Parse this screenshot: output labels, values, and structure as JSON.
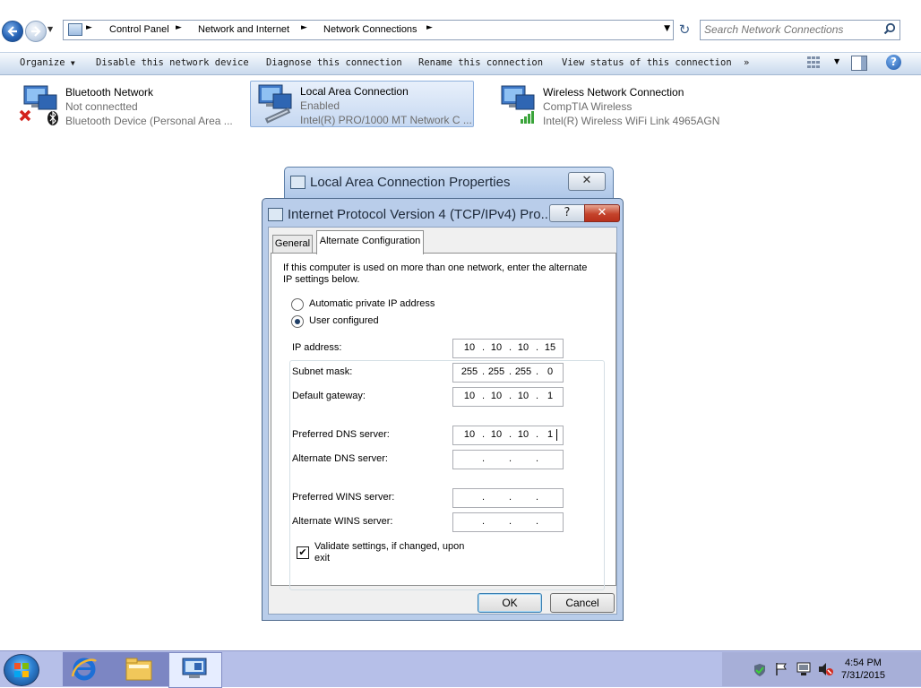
{
  "address_bar": {
    "breadcrumbs": [
      "Control Panel",
      "Network and Internet",
      "Network Connections"
    ],
    "search_placeholder": "Search Network Connections"
  },
  "command_bar": {
    "organize": "Organize",
    "disable": "Disable this network device",
    "diagnose": "Diagnose this connection",
    "rename": "Rename this connection",
    "view_status": "View status of this connection",
    "more": "»"
  },
  "connections": [
    {
      "title": "Bluetooth Network",
      "status": "Not connectted",
      "device": "Bluetooth Device (Personal Area ..."
    },
    {
      "title": "Local Area Connection",
      "status": "Enabled",
      "device": "Intel(R) PRO/1000 MT Network C ..."
    },
    {
      "title": "Wireless Network Connection",
      "status": "CompTIA Wireless",
      "device": "Intel(R) Wireless WiFi Link 4965AGN"
    }
  ],
  "lac_dialog": {
    "title": "Local Area Connection Properties"
  },
  "ipv4_dialog": {
    "title": "Internet Protocol Version 4 (TCP/IPv4) Pro...",
    "help_btn": "?",
    "close_btn": "✕",
    "tabs": [
      "General",
      "Alternate Configuration"
    ],
    "active_tab": "Alternate Configuration",
    "intro": "If this computer is used on more than one network, enter the alternate IP settings below.",
    "radio_auto": "Automatic private IP address",
    "radio_user": "User configured",
    "selected_radio": "User configured",
    "fields": [
      {
        "label": "IP address:",
        "octets": [
          "10",
          "10",
          "10",
          "15"
        ]
      },
      {
        "label": "Subnet mask:",
        "octets": [
          "255",
          "255",
          "255",
          "0"
        ]
      },
      {
        "label": "Default gateway:",
        "octets": [
          "10",
          "10",
          "10",
          "1"
        ]
      },
      {
        "label": "Preferred DNS server:",
        "octets": [
          "10",
          "10",
          "10",
          "1"
        ]
      },
      {
        "label": "Alternate DNS server:",
        "octets": [
          "",
          "",
          "",
          ""
        ]
      },
      {
        "label": "Preferred WINS server:",
        "octets": [
          "",
          "",
          "",
          ""
        ]
      },
      {
        "label": "Alternate WINS server:",
        "octets": [
          "",
          "",
          "",
          ""
        ]
      }
    ],
    "validate_label": "Validate settings, if changed, upon exit",
    "validate_checked": true,
    "ok": "OK",
    "cancel": "Cancel"
  },
  "taskbar": {
    "time": "4:54 PM",
    "date": "7/31/2015"
  },
  "colors": {
    "taskbar": "#b6bfe8",
    "dialog_frame": "#b9cdea",
    "close_red": "#c4432b",
    "selection": "#c6d8f1"
  }
}
